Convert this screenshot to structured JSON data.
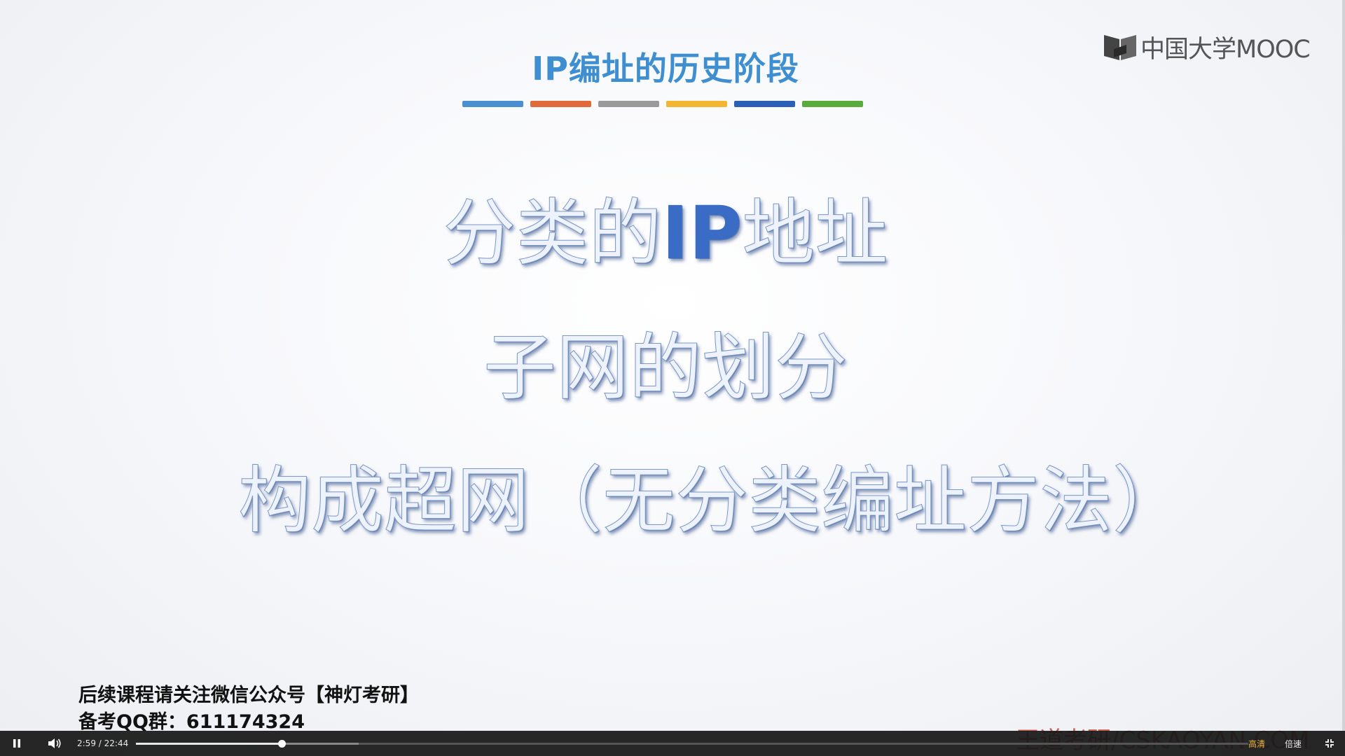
{
  "slide": {
    "title": "IP编址的历史阶段",
    "color_bar": [
      "#4a90d0",
      "#e06a3a",
      "#9a9a9a",
      "#f2b630",
      "#2c5fb5",
      "#5aaa3c"
    ],
    "headline1_pre": "分类的",
    "headline1_ip": "IP",
    "headline1_post": "地址",
    "headline2": "子网的划分",
    "headline3": "构成超网（无分类编址方法）"
  },
  "logo": {
    "text": "中国大学MOOC",
    "icon": "mooc-book-icon"
  },
  "notice": {
    "line1": "后续课程请关注微信公众号【神灯考研】",
    "line2": "备考QQ群：611174324"
  },
  "watermark": "王道考研/CSKAOYAN.COM",
  "player": {
    "current_time": "2:59",
    "separator": " / ",
    "duration": "22:44",
    "progress_fraction": 0.131,
    "buffered_fraction": 0.2,
    "quality_label": "高清",
    "speed_label": "倍速",
    "icons": [
      "pause-icon",
      "volume-icon",
      "exit-fullscreen-icon"
    ]
  }
}
